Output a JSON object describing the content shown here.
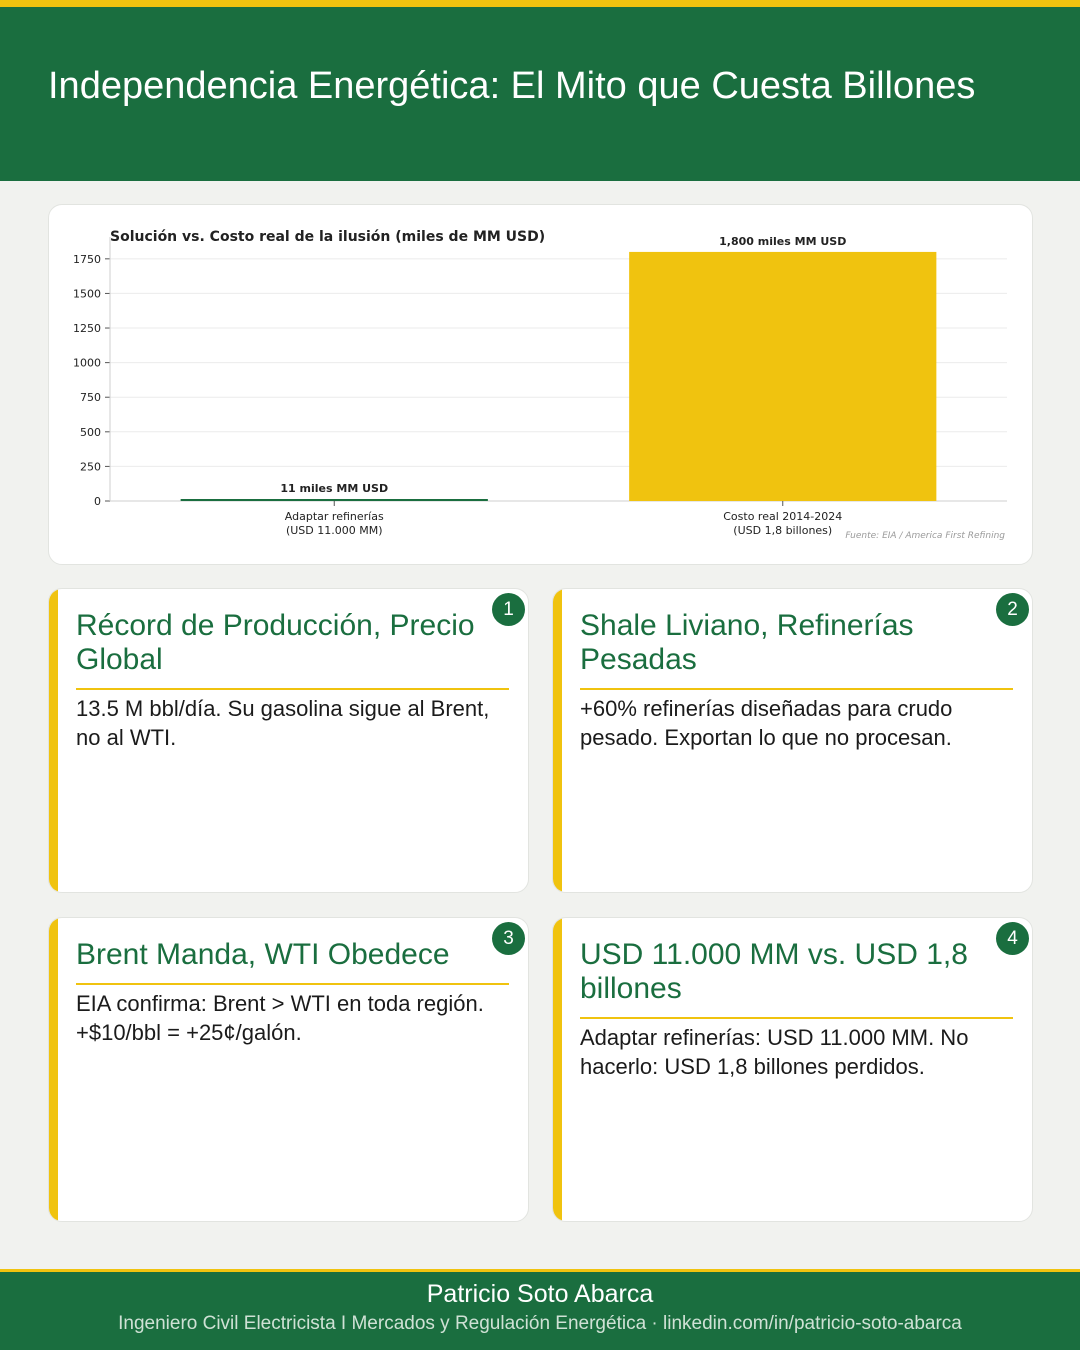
{
  "header": {
    "title": "Independencia Energética: El Mito que Cuesta Billones"
  },
  "chart_data": {
    "type": "bar",
    "title": "Solución vs. Costo real de la ilusión (miles de MM USD)",
    "categories": [
      [
        "Adaptar refinerías",
        "(USD 11.000 MM)"
      ],
      [
        "Costo real 2014-2024",
        "(USD 1,8 billones)"
      ]
    ],
    "values": [
      11,
      1800
    ],
    "data_labels": [
      "11 miles MM USD",
      "1,800 miles MM USD"
    ],
    "colors": [
      "#1a6e3f",
      "#f0c30f"
    ],
    "ylim": [
      0,
      1850
    ],
    "yticks": [
      0,
      250,
      500,
      750,
      1000,
      1250,
      1500,
      1750
    ],
    "grid": true,
    "source": "Fuente: EIA / America First Refining"
  },
  "cards": [
    {
      "number": "1",
      "title": "Récord de Producción, Precio Global",
      "body": "13.5 M bbl/día. Su gasolina sigue al Brent, no al WTI."
    },
    {
      "number": "2",
      "title": "Shale Liviano, Refinerías Pesadas",
      "body": "+60% refinerías diseñadas para crudo pesado. Exportan lo que no procesan."
    },
    {
      "number": "3",
      "title": "Brent Manda, WTI Obedece",
      "body": "EIA confirma: Brent > WTI en toda región. +$10/bbl = +25¢/galón."
    },
    {
      "number": "4",
      "title": "USD 11.000 MM vs. USD 1,8 billones",
      "body": "Adaptar refinerías: USD 11.000 MM. No hacerlo: USD 1,8 billones perdidos."
    }
  ],
  "footer": {
    "name": "Patricio Soto Abarca",
    "subtitle": "Ingeniero Civil Electricista I Mercados y Regulación Energética  ·  linkedin.com/in/patricio-soto-abarca"
  }
}
